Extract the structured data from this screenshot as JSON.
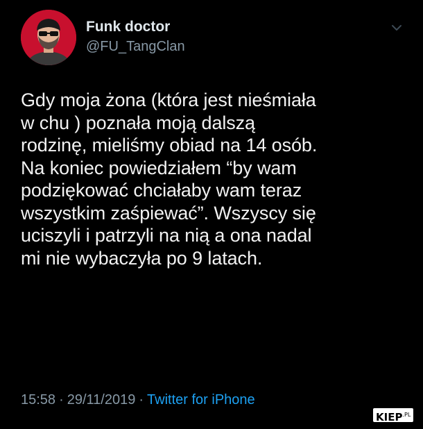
{
  "author": {
    "display_name": "Funk doctor",
    "handle": "@FU_TangClan",
    "avatar_icon": "avatar-man-sunglasses-icon"
  },
  "tweet": {
    "lines": [
      "Gdy moja żona (która jest nieśmiała",
      "w chu ) poznała moją dalszą",
      "rodzinę, mieliśmy obiad na 14 osób.",
      "Na koniec powiedziałem “by wam",
      "podziękować chciałaby wam teraz",
      "wszystkim zaśpiewać”. Wszyscy się",
      "uciszyli i patrzyli na nią a ona nadal",
      "mi nie wybaczyła po 9 latach."
    ]
  },
  "meta": {
    "time": "15:58",
    "separator": "·",
    "date": "29/11/2019",
    "source": "Twitter for iPhone"
  },
  "watermark": {
    "text": "KIEP",
    "suffix": ".PL"
  },
  "colors": {
    "background": "#000000",
    "link": "#1da1f2",
    "muted": "#8899a6",
    "avatar_bg": "#c8102e"
  }
}
